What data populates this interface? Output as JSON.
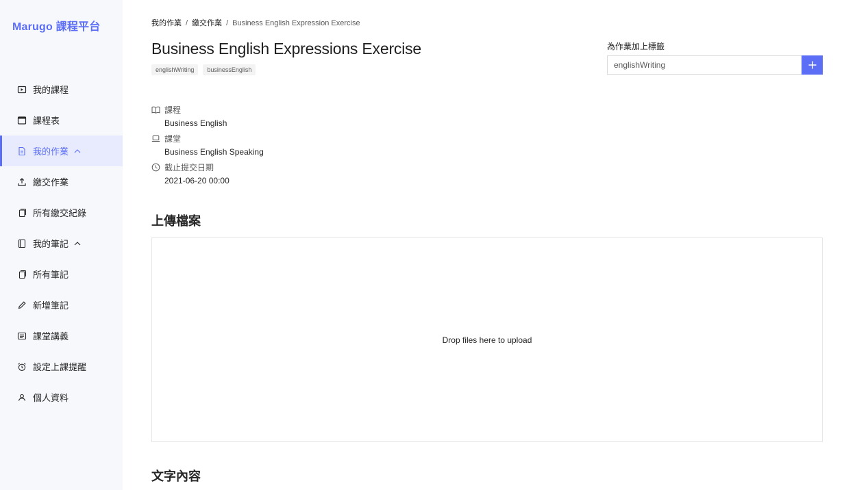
{
  "brand": "Marugo 課程平台",
  "nav": [
    {
      "label": "我的課程",
      "icon": "play-square-icon"
    },
    {
      "label": "課程表",
      "icon": "calendar-icon"
    },
    {
      "label": "我的作業",
      "icon": "file-text-icon",
      "active": true,
      "expanded": true
    },
    {
      "label": "繳交作業",
      "icon": "upload-icon"
    },
    {
      "label": "所有繳交紀錄",
      "icon": "copy-icon"
    },
    {
      "label": "我的筆記",
      "icon": "book-icon",
      "expanded": true
    },
    {
      "label": "所有筆記",
      "icon": "copy-icon"
    },
    {
      "label": "新增筆記",
      "icon": "edit-icon"
    },
    {
      "label": "課堂講義",
      "icon": "profile-icon"
    },
    {
      "label": "設定上課提醒",
      "icon": "alarm-clock-icon"
    },
    {
      "label": "個人資料",
      "icon": "user-icon"
    }
  ],
  "breadcrumb": {
    "item1": "我的作業",
    "item2": "繳交作業",
    "current": "Business English Expression Exercise",
    "separator": "/"
  },
  "page": {
    "title": "Business English Expressions Exercise",
    "tags": [
      "englishWriting",
      "businessEnglish"
    ]
  },
  "tagger": {
    "label": "為作業加上標籤",
    "value": "englishWriting"
  },
  "meta": [
    {
      "label": "課程",
      "value": "Business English",
      "icon": "book-open-icon"
    },
    {
      "label": "課堂",
      "value": "Business English Speaking",
      "icon": "laptop-icon"
    },
    {
      "label": "截止提交日期",
      "value": "2021-06-20 00:00",
      "icon": "clock-icon"
    }
  ],
  "upload": {
    "title": "上傳檔案",
    "dropzone_text": "Drop files here to upload"
  },
  "text_content": {
    "title": "文字內容"
  },
  "colors": {
    "accent": "#5b6ef5",
    "sidebar_bg": "#f7f8fc",
    "active_bg": "#e8ebfe"
  }
}
